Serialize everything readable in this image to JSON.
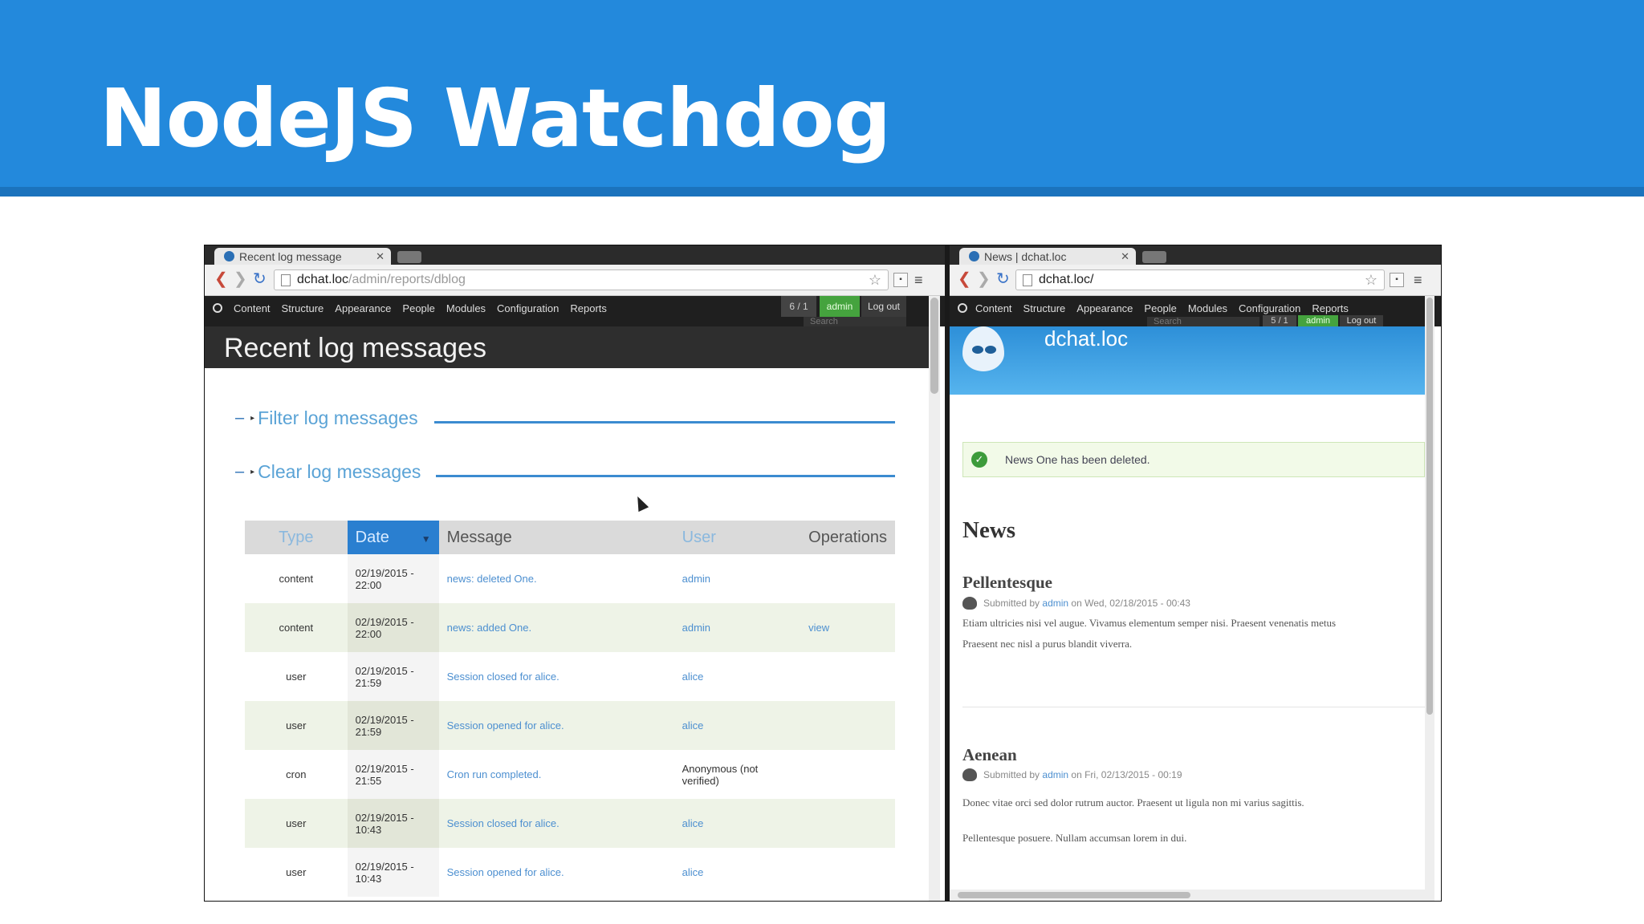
{
  "slide": {
    "title": "NodeJS Watchdog"
  },
  "left_window": {
    "tab_title": "Recent log message",
    "url_host": "dchat.loc",
    "url_path": "/admin/reports/dblog",
    "admin_menu": [
      "Content",
      "Structure",
      "Appearance",
      "People",
      "Modules",
      "Configuration",
      "Reports"
    ],
    "count": "6 / 1",
    "user_label": "admin",
    "logout_label": "Log out",
    "search_placeholder": "Search",
    "page_title": "Recent log messages",
    "filter_legend": "Filter log messages",
    "clear_legend": "Clear log messages",
    "table": {
      "headers": [
        "Type",
        "Date",
        "Message",
        "User",
        "Operations"
      ],
      "rows": [
        {
          "type": "content",
          "date": "02/19/2015 - 22:00",
          "message": "news: deleted One.",
          "user": "admin",
          "ops": ""
        },
        {
          "type": "content",
          "date": "02/19/2015 - 22:00",
          "message": "news: added One.",
          "user": "admin",
          "ops": "view"
        },
        {
          "type": "user",
          "date": "02/19/2015 - 21:59",
          "message": "Session closed for alice.",
          "user": "alice",
          "ops": ""
        },
        {
          "type": "user",
          "date": "02/19/2015 - 21:59",
          "message": "Session opened for alice.",
          "user": "alice",
          "ops": ""
        },
        {
          "type": "cron",
          "date": "02/19/2015 - 21:55",
          "message": "Cron run completed.",
          "user": "Anonymous (not verified)",
          "ops": ""
        },
        {
          "type": "user",
          "date": "02/19/2015 - 10:43",
          "message": "Session closed for alice.",
          "user": "alice",
          "ops": ""
        },
        {
          "type": "user",
          "date": "02/19/2015 - 10:43",
          "message": "Session opened for alice.",
          "user": "alice",
          "ops": ""
        }
      ]
    }
  },
  "right_window": {
    "tab_title": "News | dchat.loc",
    "url_host": "dchat.loc/",
    "admin_menu": [
      "Content",
      "Structure",
      "Appearance",
      "People",
      "Modules",
      "Configuration",
      "Reports"
    ],
    "count": "5 / 1",
    "user_label": "admin",
    "logout_label": "Log out",
    "search_placeholder": "Search",
    "site_name": "dchat.loc",
    "status_message": "News One has been deleted.",
    "news_heading": "News",
    "nodes": [
      {
        "title": "Pellentesque",
        "submitted_prefix": "Submitted by",
        "author": "admin",
        "submitted_suffix": "on Wed, 02/18/2015 - 00:43",
        "body_1": "Etiam ultricies nisi vel augue. Vivamus elementum semper nisi. Praesent venenatis metus",
        "body_2": "Praesent nec nisl a purus blandit viverra."
      },
      {
        "title": "Aenean",
        "submitted_prefix": "Submitted by",
        "author": "admin",
        "submitted_suffix": "on Fri, 02/13/2015 - 00:19",
        "body_1": "Donec vitae orci sed dolor rutrum auctor. Praesent ut ligula non mi varius sagittis.",
        "body_2": "Pellentesque posuere. Nullam accumsan lorem in dui."
      }
    ]
  }
}
